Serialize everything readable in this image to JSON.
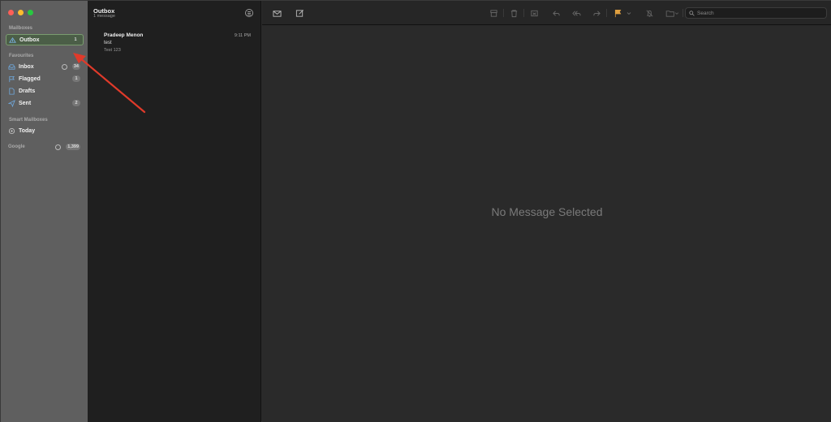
{
  "sidebar": {
    "section_mailboxes": "Mailboxes",
    "outbox": {
      "label": "Outbox",
      "count": "1"
    },
    "section_favourites": "Favourites",
    "inbox": {
      "label": "Inbox",
      "count": "34"
    },
    "flagged": {
      "label": "Flagged",
      "count": "1"
    },
    "drafts": {
      "label": "Drafts"
    },
    "sent": {
      "label": "Sent",
      "count": "2"
    },
    "section_smart": "Smart Mailboxes",
    "today": {
      "label": "Today"
    },
    "section_google": "Google",
    "google_count": "1,399"
  },
  "message_list": {
    "title": "Outbox",
    "subtitle": "1 message",
    "messages": [
      {
        "from": "Pradeep Menon",
        "time": "9:11 PM",
        "subject": "test",
        "preview": "Test 123"
      }
    ]
  },
  "toolbar": {
    "search_placeholder": "Search"
  },
  "viewer": {
    "empty_text": "No Message Selected"
  },
  "colors": {
    "accent": "#4b5e47",
    "flag": "#e0a040",
    "arrow": "#e03a2a"
  }
}
